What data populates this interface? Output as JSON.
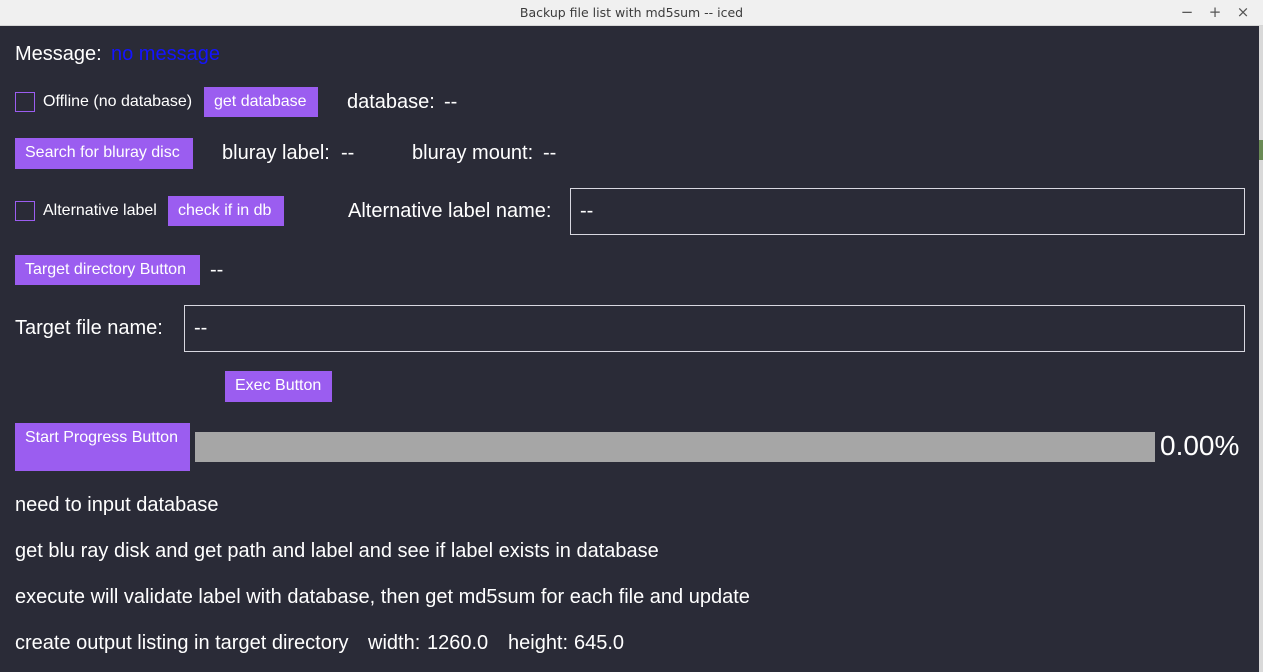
{
  "window": {
    "title": "Backup file list with md5sum -- iced",
    "minimize": "−",
    "maximize": "+",
    "close": "×"
  },
  "message": {
    "label": "Message:",
    "value": "no message"
  },
  "offline": {
    "checkbox_label": "Offline (no database)",
    "checked": false,
    "get_database_button": "get database",
    "database_label": "database:",
    "database_value": "--"
  },
  "bluray": {
    "search_button": "Search for bluray disc",
    "label_label": "bluray label:",
    "label_value": "--",
    "mount_label": "bluray mount:",
    "mount_value": "--"
  },
  "alternative": {
    "checkbox_label": "Alternative label",
    "checked": false,
    "check_button": "check if in db",
    "name_label": "Alternative label name:",
    "name_value": "--"
  },
  "target_dir": {
    "button": "Target directory Button",
    "value": "--"
  },
  "target_file": {
    "label": "Target file name:",
    "value": "--"
  },
  "exec": {
    "button": "Exec Button"
  },
  "progress": {
    "button": "Start Progress Button",
    "value": 0.0,
    "percent_text": "0.00%"
  },
  "help": {
    "line1": "need to input database",
    "line2": "get blu ray disk and get path and label and see if label exists in database",
    "line3": "execute will validate label with database, then get md5sum for each file and update",
    "line4_text": "create output listing in target directory",
    "width_label": "width:",
    "width_value": "1260.0",
    "height_label": "height:",
    "height_value": "645.0"
  },
  "colors": {
    "background": "#2a2b37",
    "accent": "#9b5df0",
    "message_text": "#1414ff",
    "progress_track": "#a6a6a6",
    "text": "#ffffff"
  }
}
